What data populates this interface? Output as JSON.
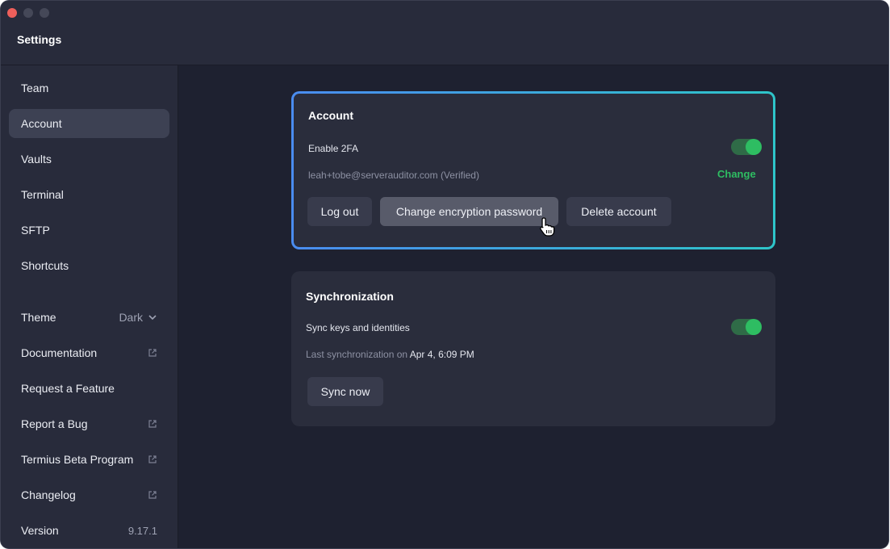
{
  "window": {
    "title": "Settings"
  },
  "sidebar": {
    "items": [
      {
        "label": "Team"
      },
      {
        "label": "Account"
      },
      {
        "label": "Vaults"
      },
      {
        "label": "Terminal"
      },
      {
        "label": "SFTP"
      },
      {
        "label": "Shortcuts"
      }
    ],
    "theme": {
      "label": "Theme",
      "value": "Dark"
    },
    "links": [
      {
        "label": "Documentation",
        "icon": "external-link-icon"
      },
      {
        "label": "Request a Feature"
      },
      {
        "label": "Report a Bug",
        "icon": "external-link-icon"
      },
      {
        "label": "Termius Beta Program",
        "icon": "external-link-icon"
      },
      {
        "label": "Changelog",
        "icon": "external-link-icon"
      }
    ],
    "version": {
      "label": "Version",
      "value": "9.17.1"
    }
  },
  "account": {
    "title": "Account",
    "twofa_label": "Enable 2FA",
    "twofa_enabled": true,
    "email": "leah+tobe@serverauditor.com (Verified)",
    "change_label": "Change",
    "buttons": {
      "logout": "Log out",
      "change_password": "Change encryption password",
      "delete": "Delete account"
    }
  },
  "sync": {
    "title": "Synchronization",
    "toggle_label": "Sync keys and identities",
    "toggle_enabled": true,
    "last_sync_label": "Last synchronization on",
    "last_sync_value": "Apr 4, 6:09 PM",
    "sync_button": "Sync now"
  },
  "colors": {
    "accent_green": "#2ebd62",
    "highlight_gradient_start": "#4a8cf0",
    "highlight_gradient_end": "#2ec5c9"
  }
}
